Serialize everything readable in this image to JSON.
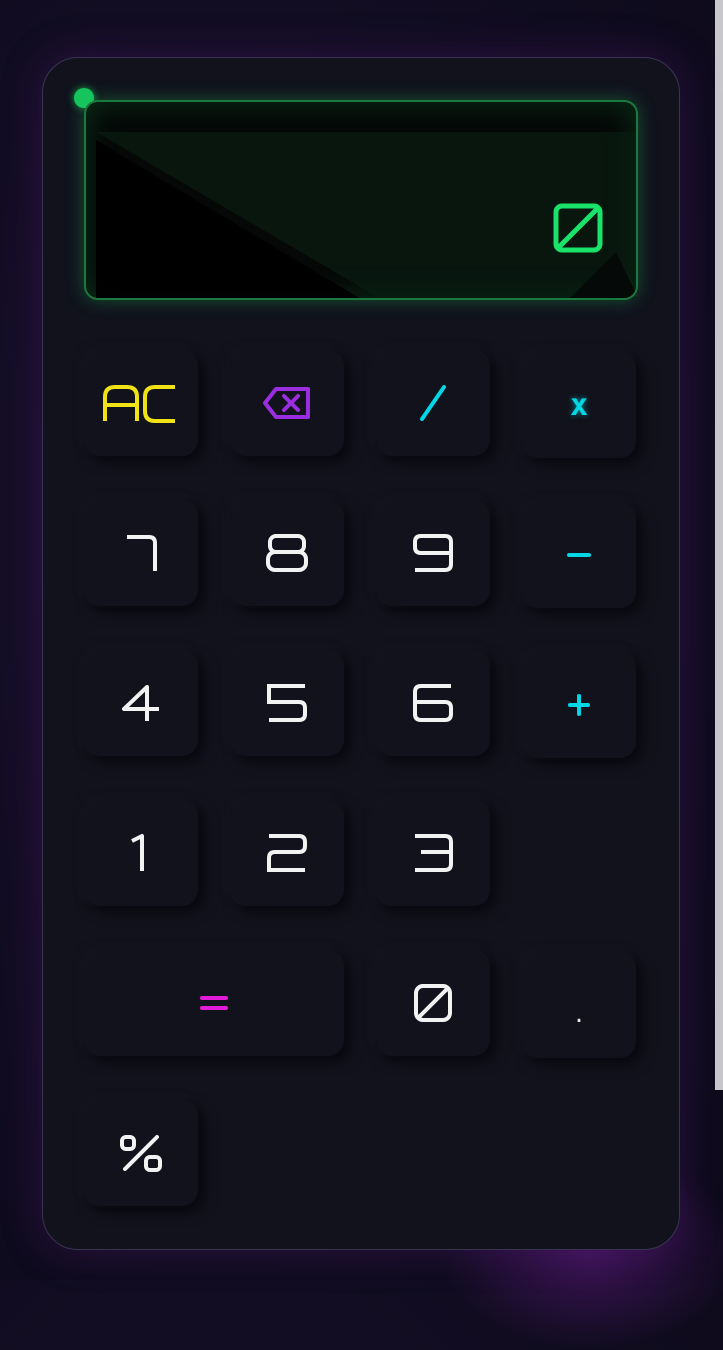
{
  "display": {
    "value": "0"
  },
  "keys": {
    "clear": "AC",
    "backspace": "backspace",
    "divide": "/",
    "multiply": "x",
    "seven": "7",
    "eight": "8",
    "nine": "9",
    "minus": "-",
    "four": "4",
    "five": "5",
    "six": "6",
    "plus": "+",
    "one": "1",
    "two": "2",
    "three": "3",
    "equals": "=",
    "zero": "0",
    "decimal": ".",
    "percent": "%"
  },
  "colors": {
    "clear": "#f1e215",
    "backspace": "#9b2de0",
    "operator": "#00d7e6",
    "equals": "#e21ad9",
    "digit": "#f2f2f2",
    "display": "#19e36b"
  }
}
